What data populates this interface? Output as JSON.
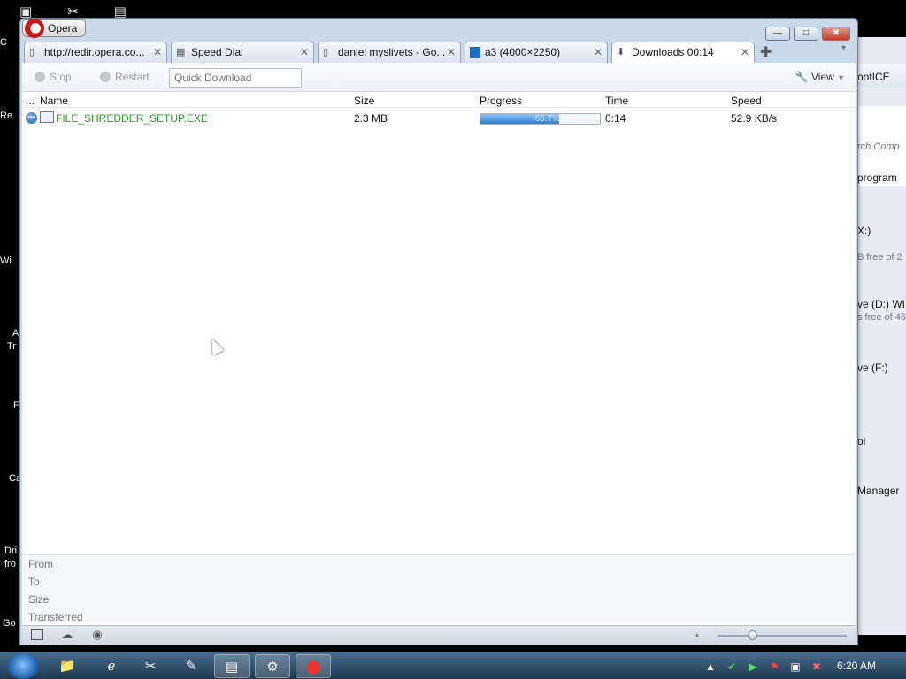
{
  "desktop": {
    "labels": [
      "C",
      "Re",
      "Wi",
      "A",
      "Tr",
      "E",
      "Ca",
      "Dri",
      "fro",
      "Go"
    ]
  },
  "background_window": {
    "items": [
      "ootICE",
      "rch Comp",
      "program",
      "X:)",
      "B free of 2",
      "ve (D:) WI",
      "s free of 46",
      "ve (F:)",
      "ol",
      "Manager"
    ]
  },
  "opera": {
    "menu_label": "Opera",
    "window_controls": {
      "minimize": "—",
      "maximize": "□",
      "close": "✖"
    },
    "tabs": [
      {
        "icon": "page-icon",
        "label": "http://redir.opera.co..."
      },
      {
        "icon": "speed-dial-icon",
        "label": "Speed Dial"
      },
      {
        "icon": "page-icon",
        "label": "daniel myslivets - Go..."
      },
      {
        "icon": "image-icon",
        "label": "a3 (4000×2250)"
      },
      {
        "icon": "download-icon",
        "label": "Downloads 00:14"
      }
    ],
    "toolbar": {
      "stop_label": "Stop",
      "restart_label": "Restart",
      "quick_download_placeholder": "Quick Download",
      "view_label": "View"
    },
    "columns": {
      "menu": "...",
      "name": "Name",
      "size": "Size",
      "progress": "Progress",
      "time": "Time",
      "speed": "Speed"
    },
    "downloads": [
      {
        "name": "FILE_SHREDDER_SETUP.EXE",
        "size": "2.3 MB",
        "progress_percent": 65.7,
        "progress_text": "65.7%",
        "time": "0:14",
        "speed": "52.9 KB/s"
      }
    ],
    "details": {
      "from_label": "From",
      "to_label": "To",
      "size_label": "Size",
      "transferred_label": "Transferred"
    }
  },
  "taskbar": {
    "clock": "6:20 AM"
  }
}
